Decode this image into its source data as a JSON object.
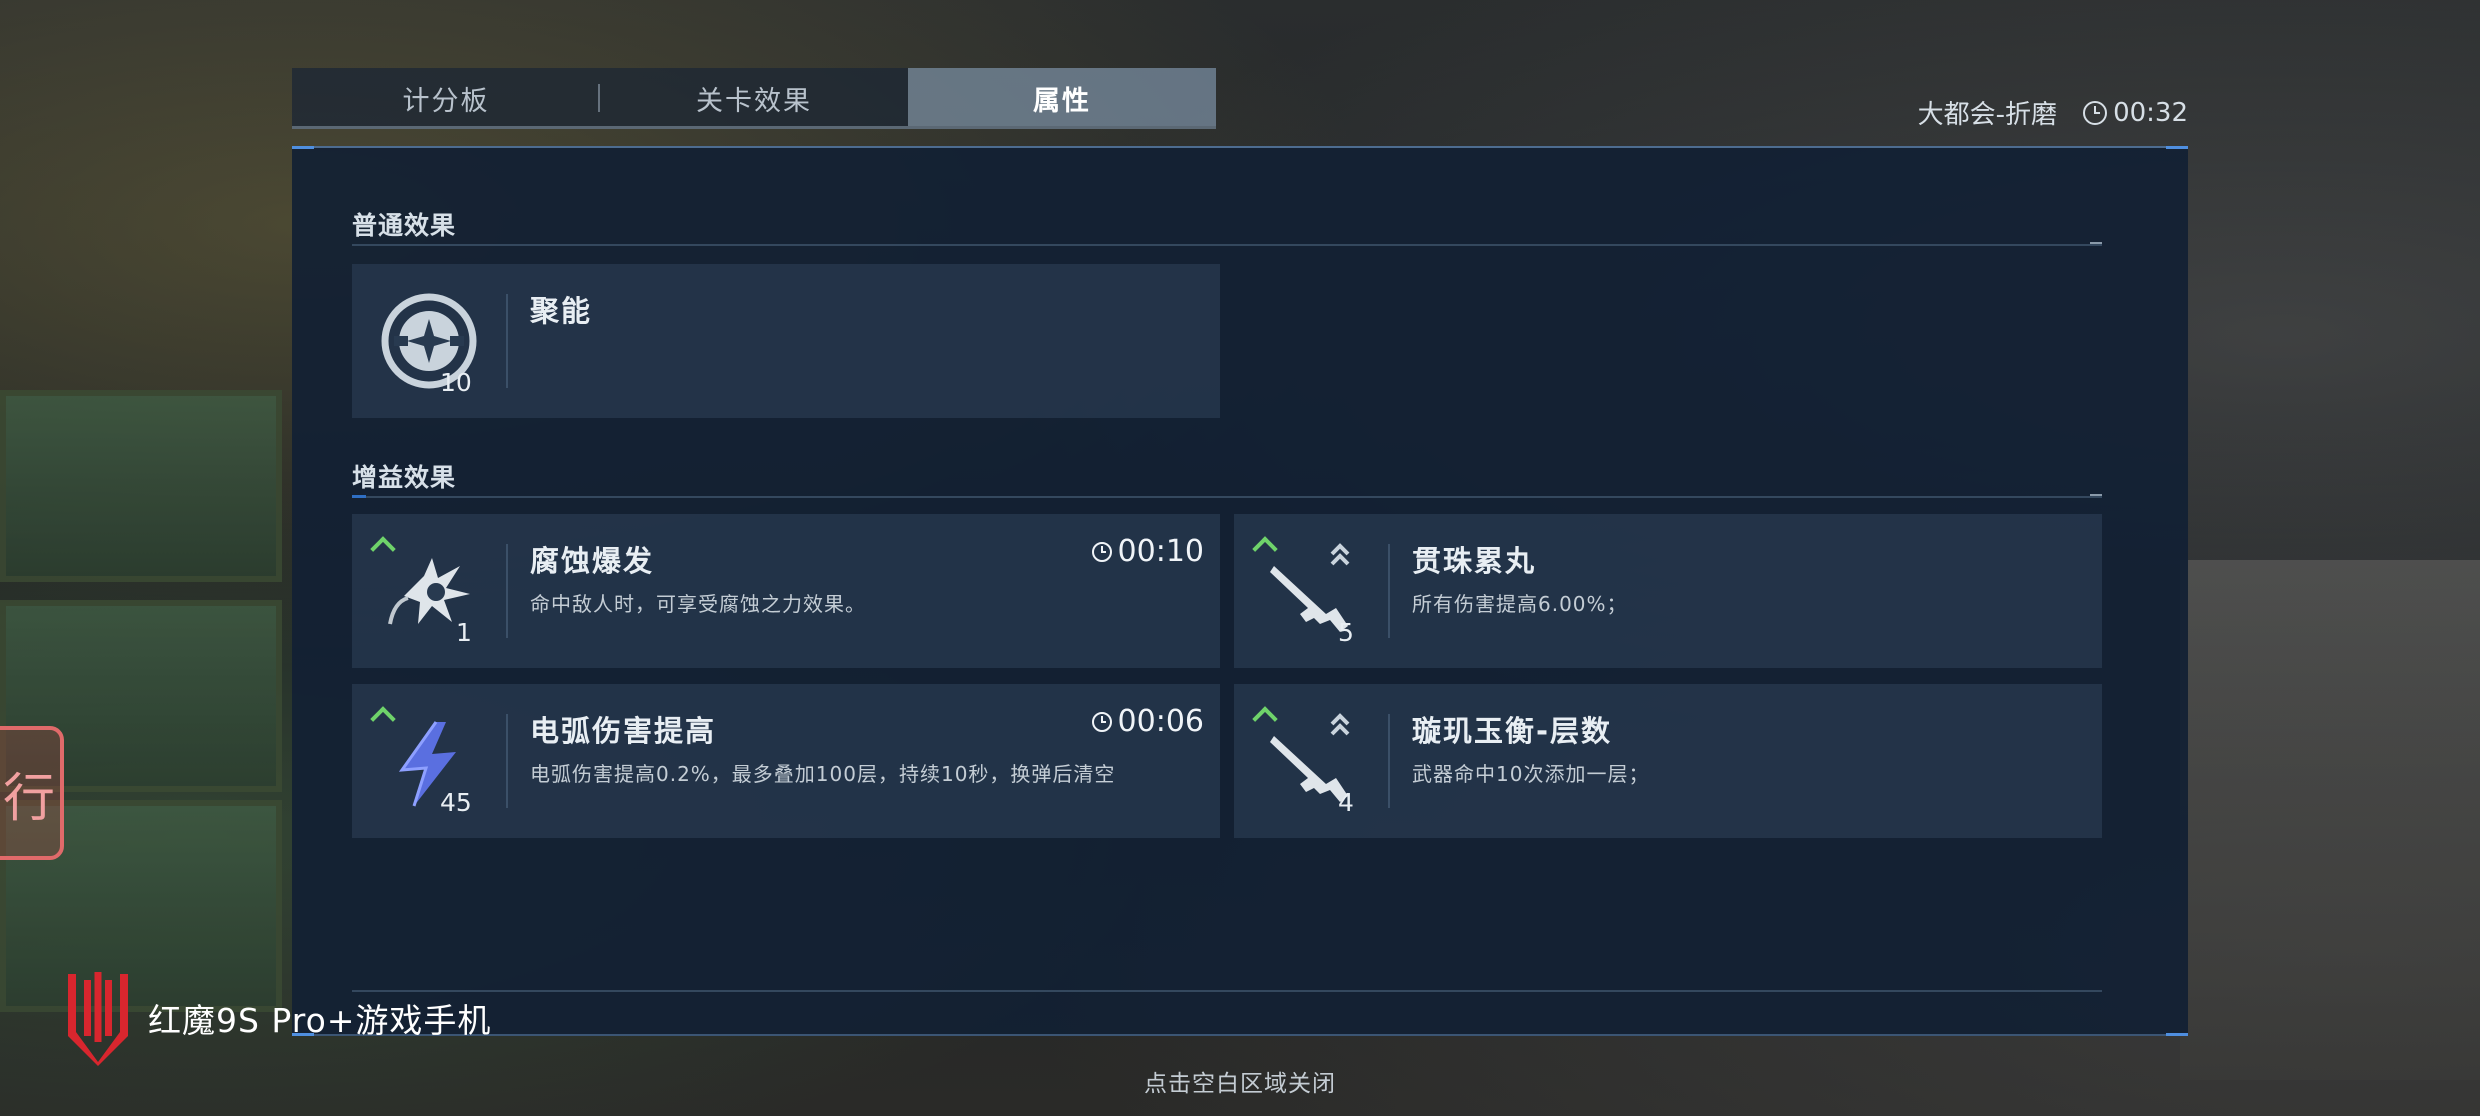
{
  "tabs": [
    {
      "label": "计分板",
      "active": false
    },
    {
      "label": "关卡效果",
      "active": false
    },
    {
      "label": "属性",
      "active": true
    }
  ],
  "header": {
    "map_name": "大都会-折磨",
    "timer": "00:32"
  },
  "sections": {
    "normal_title": "普通效果",
    "buff_title": "增益效果"
  },
  "normal_effects": [
    {
      "name": "聚能",
      "desc": "",
      "stack": "10",
      "icon": "focus-energy-icon"
    }
  ],
  "buff_effects": [
    {
      "name": "腐蚀爆发",
      "desc": "命中敌人时，可享受腐蚀之力效果。",
      "stack": "1",
      "timer": "00:10",
      "icon": "corrosion-burst-icon"
    },
    {
      "name": "贯珠累丸",
      "desc": "所有伤害提高6.00%；",
      "stack": "5",
      "timer": "",
      "icon": "rifle-icon"
    },
    {
      "name": "电弧伤害提高",
      "desc": "电弧伤害提高0.2%，最多叠加100层，持续10秒，换弹后清空",
      "stack": "45",
      "timer": "00:06",
      "icon": "lightning-icon"
    },
    {
      "name": "璇玑玉衡-层数",
      "desc": "武器命中10次添加一层；",
      "stack": "4",
      "timer": "",
      "icon": "rifle-icon"
    }
  ],
  "footer": {
    "close_hint": "点击空白区域关闭",
    "brand_text": "红魔9S Pro+游戏手机",
    "side_button_glyph": "行"
  },
  "colors": {
    "panel": "#122034",
    "card": "#283a50",
    "up_arrow": "#6fd36a",
    "lightning": "#5a6fe0",
    "brand_red": "#d8262e"
  }
}
